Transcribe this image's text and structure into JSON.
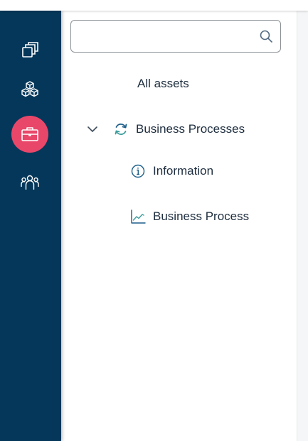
{
  "navigation": {
    "items": [
      {
        "icon": "copy-stack-icon",
        "active": false
      },
      {
        "icon": "cubes-icon",
        "active": false
      },
      {
        "icon": "briefcase-icon",
        "active": true
      },
      {
        "icon": "people-group-icon",
        "active": false
      }
    ],
    "rail_color": "#05375a",
    "active_color": "#e9476a"
  },
  "search": {
    "value": "",
    "placeholder": ""
  },
  "tree": {
    "root_label": "All assets",
    "group": {
      "label": "Business Processes",
      "expanded": true,
      "icon": "refresh-cycle-icon",
      "children": [
        {
          "label": "Information",
          "icon": "info-icon"
        },
        {
          "label": "Business Process",
          "icon": "line-chart-icon"
        }
      ]
    }
  }
}
